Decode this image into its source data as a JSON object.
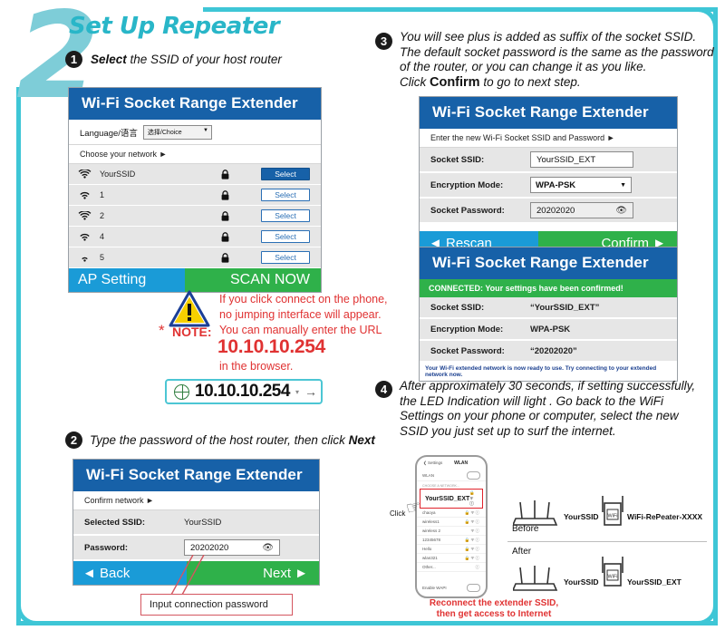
{
  "section": {
    "number": "2",
    "title": "Set Up Repeater"
  },
  "steps": {
    "one": {
      "num": "1",
      "text_bold": "Select",
      "text_rest": " the SSID of your host router"
    },
    "two": {
      "num": "2",
      "text_a": "Type the password of the host router,  then click ",
      "text_bold": "Next"
    },
    "three": {
      "num": "3",
      "line1": "You will see plus is added as suffix of the socket SSID.",
      "line2": "The default socket password is the same as the password",
      "line3": "of the router, or you can change it as you like.",
      "line4_a": "Click ",
      "line4_bold": "Confirm",
      "line4_b": " to go to next step."
    },
    "four": {
      "num": "4",
      "line1": "After approximately 30 seconds, if setting successfully,",
      "line2": "the LED Indication will light . Go back to the WiFi",
      "line3": "Settings on your phone or computer, select the new",
      "line4": "SSID you just set up to surf the internet."
    }
  },
  "panel_scan": {
    "title": "Wi-Fi Socket Range Extender",
    "language_label": "Language/语言",
    "language_value": "选择/Choice",
    "choose_network": "Choose your network  ►",
    "networks": [
      {
        "ssid": "YourSSID",
        "bars": 4,
        "locked": true,
        "select_label": "Select",
        "primary": true
      },
      {
        "ssid": "1",
        "bars": 3,
        "locked": true,
        "select_label": "Select",
        "primary": false
      },
      {
        "ssid": "2",
        "bars": 4,
        "locked": true,
        "select_label": "Select",
        "primary": false
      },
      {
        "ssid": "4",
        "bars": 3,
        "locked": true,
        "select_label": "Select",
        "primary": false
      },
      {
        "ssid": "5",
        "bars": 2,
        "locked": true,
        "select_label": "Select",
        "primary": false
      }
    ],
    "footer_left": "AP Setting",
    "footer_right": "SCAN NOW"
  },
  "panel_confirm_network": {
    "title": "Wi-Fi Socket Range Extender",
    "subtitle": "Confirm network  ►",
    "rows": [
      {
        "label": "Selected SSID:",
        "value": "YourSSID",
        "type": "text"
      },
      {
        "label": "Password:",
        "value": "20202020",
        "type": "password"
      }
    ],
    "footer_left": "◄ Back",
    "footer_right": "Next  ►"
  },
  "panel_socket_setup": {
    "title": "Wi-Fi Socket Range Extender",
    "subtitle": "Enter the new Wi-Fi Socket SSID and Password  ►",
    "rows": [
      {
        "label": "Socket SSID:",
        "value": "YourSSID_EXT",
        "type": "text"
      },
      {
        "label": "Encryption Mode:",
        "value": "WPA-PSK",
        "type": "select"
      },
      {
        "label": "Socket Password:",
        "value": "20202020",
        "type": "password"
      }
    ],
    "footer_left": "◄ Rescan",
    "footer_right": "Confirm  ►"
  },
  "panel_connected": {
    "title": "Wi-Fi Socket Range Extender",
    "banner": "CONNECTED: Your settings have been confirmed!",
    "rows": [
      {
        "label": "Socket SSID:",
        "value": "“YourSSID_EXT”"
      },
      {
        "label": "Encryption Mode:",
        "value": "WPA-PSK"
      },
      {
        "label": "Socket Password:",
        "value": "“20202020”"
      }
    ],
    "footer_note": "Your Wi-Fi extended network is now ready to use. Try connecting to your extended network now."
  },
  "note": {
    "star": "*",
    "label": "NOTE:",
    "line1": "If you click connect on the phone,",
    "line2": "no jumping interface will appear.",
    "line3": "You can manually enter the URL",
    "ip": "10.10.10.254",
    "line4": "in the browser.",
    "url_value": "10.10.10.254",
    "url_caret": "▾",
    "url_go": "→"
  },
  "callout": {
    "text": "Input connection password"
  },
  "phone": {
    "back_label": "❮ Settings",
    "title": "WLAN",
    "toggle_label": "WLAN",
    "section_header": "CHOOSE A NETWORK...",
    "selected_ssid": "YourSSID_EXT",
    "networks": [
      "chaoya",
      "wireless1",
      "wireless 2",
      "12345678",
      "Hello",
      "wlan321",
      "Other..."
    ],
    "footer_label": "Enable WAPI",
    "click_label": "Click"
  },
  "diagram": {
    "before_label": "Before",
    "after_label": "After",
    "before_router": "YourSSID",
    "before_extender": "WiFi-RePeater-XXXX",
    "after_router": "YourSSID",
    "after_extender": "YourSSID_EXT",
    "wifi_badge": "WiFi"
  },
  "red_caption": {
    "line1": "Reconnect the extender SSID,",
    "line2": "then get access to Internet"
  },
  "colors": {
    "teal": "#3ec6d6",
    "teal_light": "#7ecdd8",
    "blue_header": "#1761a8",
    "blue_bar": "#1a9bd7",
    "green": "#2fb14a",
    "red": "#e03232"
  }
}
